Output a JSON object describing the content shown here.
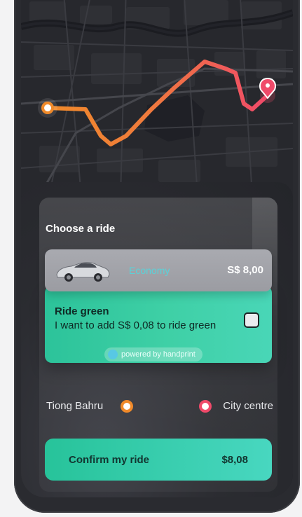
{
  "ride": {
    "title": "Choose a ride",
    "economy": {
      "label": "Economy",
      "price": "S$ 8,00",
      "icon": "car-icon"
    },
    "green": {
      "title": "Ride green",
      "description": "I want to add S$ 0,08 to ride green",
      "powered": "powered by handprint",
      "checked": false,
      "icon": "handprint-icon"
    },
    "route": {
      "from": "Tiong Bahru",
      "to": "City centre"
    },
    "confirm": {
      "label": "Confirm my ride",
      "price": "$8,08"
    }
  },
  "colors": {
    "route_start": "#f08a2a",
    "route_end": "#f04a6a",
    "accent_green": "#2cc39a",
    "economy_label": "#5ad2d8"
  }
}
